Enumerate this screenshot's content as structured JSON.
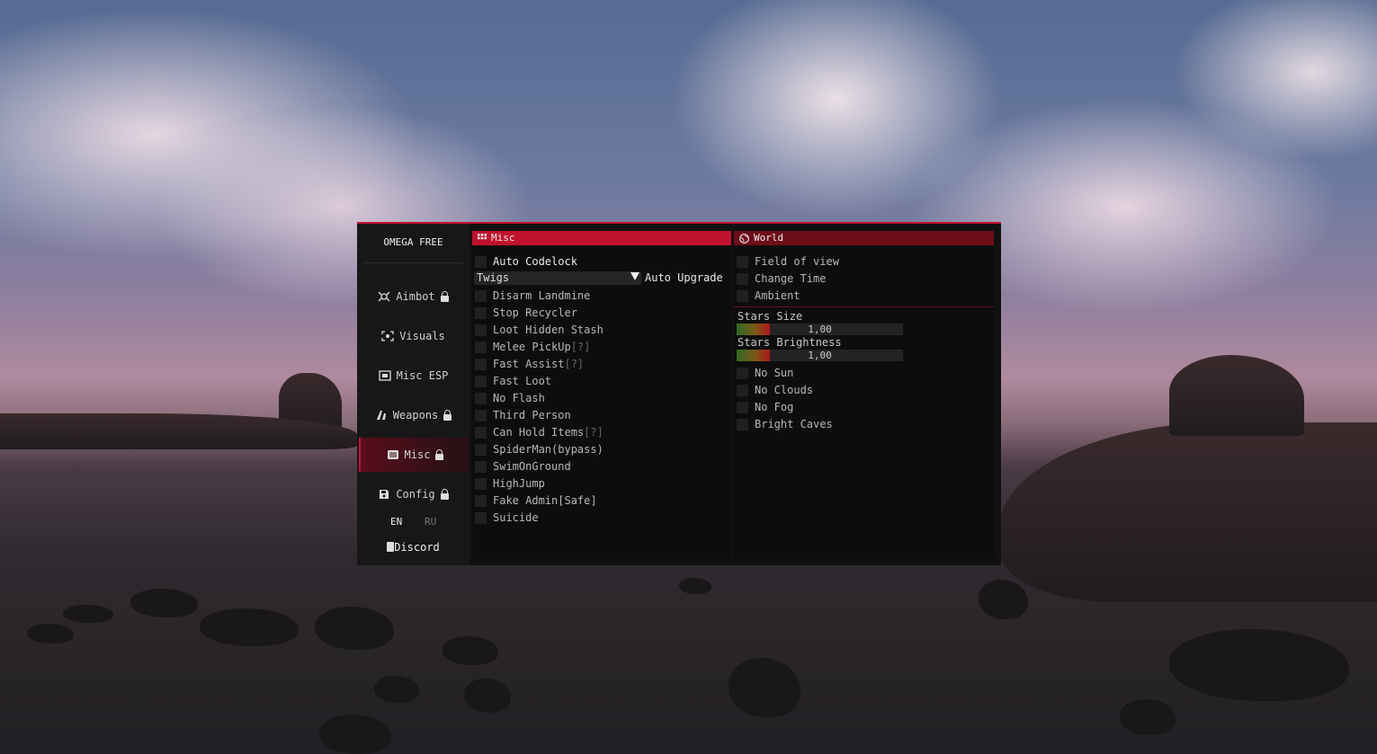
{
  "brand": "OMEGA FREE",
  "nav": [
    {
      "label": "Aimbot",
      "icon": "crosshair-icon",
      "locked": true,
      "active": false
    },
    {
      "label": "Visuals",
      "icon": "eye-scan-icon",
      "locked": false,
      "active": false
    },
    {
      "label": "Misc ESP",
      "icon": "box-esp-icon",
      "locked": false,
      "active": false
    },
    {
      "label": "Weapons",
      "icon": "weapons-icon",
      "locked": true,
      "active": false
    },
    {
      "label": "Misc",
      "icon": "list-icon",
      "locked": true,
      "active": true
    },
    {
      "label": "Config",
      "icon": "save-icon",
      "locked": true,
      "active": false
    }
  ],
  "languages": [
    "EN",
    "RU"
  ],
  "discord": "Discord",
  "misc": {
    "title": "Misc",
    "auto_codelock": "Auto Codelock",
    "upgrade_select": "Twigs",
    "auto_upgrade": "Auto Upgrade",
    "items": [
      {
        "label": "Disarm Landmine",
        "hint": ""
      },
      {
        "label": "Stop Recycler",
        "hint": ""
      },
      {
        "label": "Loot Hidden Stash",
        "hint": ""
      },
      {
        "label": "Melee PickUp",
        "hint": "[?]"
      },
      {
        "label": "Fast Assist",
        "hint": "[?]"
      },
      {
        "label": "Fast Loot",
        "hint": ""
      },
      {
        "label": "No Flash",
        "hint": ""
      },
      {
        "label": "Third Person",
        "hint": ""
      },
      {
        "label": "Can Hold Items",
        "hint": "[?]"
      },
      {
        "label": "SpiderMan(bypass)",
        "hint": ""
      },
      {
        "label": "SwimOnGround",
        "hint": ""
      },
      {
        "label": "HighJump",
        "hint": ""
      },
      {
        "label": "Fake Admin[Safe]",
        "hint": ""
      },
      {
        "label": "Suicide",
        "hint": ""
      }
    ]
  },
  "world": {
    "title": "World",
    "top_items": [
      "Field of view",
      "Change Time",
      "Ambient"
    ],
    "sliders": [
      {
        "label": "Stars Size",
        "value": "1,00",
        "fill": 0.2
      },
      {
        "label": "Stars Brightness",
        "value": "1,00",
        "fill": 0.2
      }
    ],
    "bottom_items": [
      "No Sun",
      "No Clouds",
      "No Fog",
      "Bright Caves"
    ]
  },
  "colors": {
    "accent": "#c0122e",
    "world_header": "#6e0d18",
    "panel": "#0d0d0d"
  }
}
